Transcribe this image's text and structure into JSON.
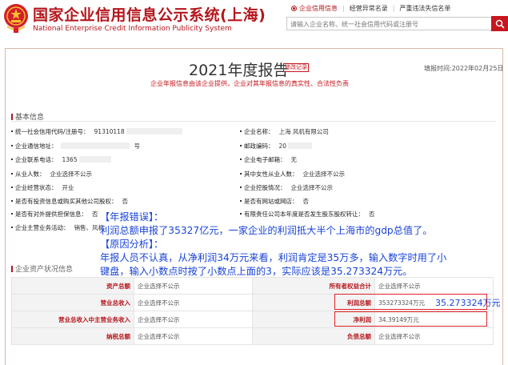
{
  "header": {
    "site_title": "国家企业信用信息公示系统(上海)",
    "site_subtitle": "National Enterprise Credit Information Publicity System",
    "nav": [
      {
        "label": "企业信用信息",
        "active": true
      },
      {
        "label": "经营异常名录",
        "active": false
      },
      {
        "label": "严重违法失信名单",
        "active": false
      }
    ],
    "search_placeholder": "请输入企业名称、统一社会信用代码或注册号",
    "search_icon": "magnifier-icon"
  },
  "report": {
    "title": "2021年度报告",
    "badge": "修改记录",
    "fill_date": "填报时间:2022年02月25日",
    "notice": "企业年报信息由该企业提供，企业对其年报信息的真实性、合法性负责"
  },
  "basic": {
    "section_title": "基本信息",
    "left": [
      {
        "label": "统一社会信用代码/注册号：",
        "value": "91310118"
      },
      {
        "label": "企业通信地址：",
        "value": "号"
      },
      {
        "label": "企业联系电话：",
        "value": "1365"
      },
      {
        "label": "从业人数：",
        "value": "企业选择不公示"
      },
      {
        "label": "企业经营状态：",
        "value": "开业"
      },
      {
        "label": "是否有投资信息或购买其他公司股权：",
        "value": "否"
      },
      {
        "label": "是否有对外提供担保信息：",
        "value": "否"
      },
      {
        "label": "企业主营业务活动：",
        "value": "销售、风机"
      }
    ],
    "right": [
      {
        "label": "企业名称：",
        "value": "上海  风机有限公司"
      },
      {
        "label": "邮政编码：",
        "value": "20"
      },
      {
        "label": "企业电子邮箱：",
        "value": "无"
      },
      {
        "label": "其中女性从业人数：",
        "value": "企业选择不公示"
      },
      {
        "label": "企业控股情况：",
        "value": "企业选择不公示"
      },
      {
        "label": "是否有网站或网店：",
        "value": "否"
      },
      {
        "label": "有限责任公司本年度是否发生股东股权转让：",
        "value": "否"
      }
    ]
  },
  "annotation": {
    "lines": [
      "【年报错误】：",
      "利润总额申报了35327亿元，一家企业的利润抵大半个上海市的gdp总值了。",
      "【原因分析】：",
      "年报人员不认真，从净利润34万元来看，利润肯定是35万多，输入数字时用了小",
      "键盘，输入小数点时按了小数点上面的3，实际应该是35.273324万元。"
    ],
    "profit_correction": "35.273324万元",
    "color": "#1a44d8"
  },
  "assets": {
    "section_title": "企业资产状况信息",
    "rows": [
      {
        "k1": "资产总额",
        "v1": "企业选择不公示",
        "k2": "所有者权益合计",
        "v2": "企业选择不公示"
      },
      {
        "k1": "营业总收入",
        "v1": "企业选择不公示",
        "k2": "利润总额",
        "v2": "353273324万元"
      },
      {
        "k1": "营业总收入中主营业务收入",
        "v1": "企业选择不公示",
        "k2": "净利润",
        "v2": "34.39149万元"
      },
      {
        "k1": "纳税总额",
        "v1": "企业选择不公示",
        "k2": "负债总额",
        "v2": "企业选择不公示"
      }
    ]
  },
  "colors": {
    "brand_red": "#b5161c",
    "highlight_box": "#e0202a"
  }
}
